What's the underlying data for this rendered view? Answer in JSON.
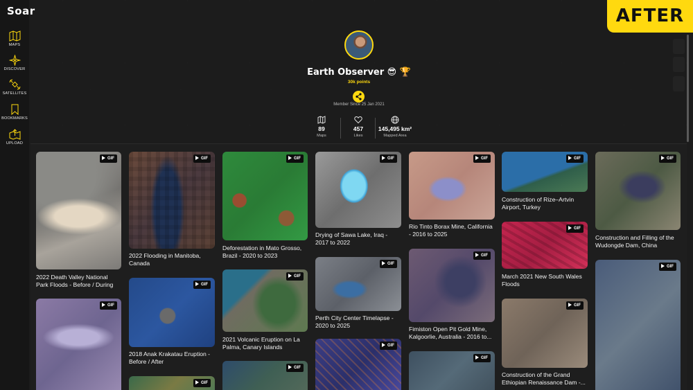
{
  "app": {
    "logo": "Soar",
    "badge": "AFTER"
  },
  "sidebar": {
    "items": [
      {
        "label": "MAPS",
        "icon": "map-icon"
      },
      {
        "label": "DISCOVER",
        "icon": "compass-icon"
      },
      {
        "label": "SATELLITES",
        "icon": "satellite-icon"
      },
      {
        "label": "BOOKMARKS",
        "icon": "bookmark-icon"
      },
      {
        "label": "UPLOAD",
        "icon": "upload-icon"
      }
    ]
  },
  "profile": {
    "name": "Earth Observer 😎 🏆",
    "points": "30k points",
    "member_since": "Member Since 25 Jan 2021",
    "stats": [
      {
        "value": "89",
        "label": "Maps",
        "icon": "map-icon"
      },
      {
        "value": "457",
        "label": "Likes",
        "icon": "heart-icon"
      },
      {
        "value": "145,495 km²",
        "label": "Mapped Area",
        "icon": "globe-icon"
      }
    ]
  },
  "gif_badge": "GIF",
  "colors": {
    "accent": "#ffd90f",
    "background": "#1b1b1b"
  },
  "cards": [
    {
      "title": "2022 Death Valley National Park Floods - Before / During"
    },
    {
      "title": ""
    },
    {
      "title": "2022 Flooding in Manitoba, Canada"
    },
    {
      "title": "2018 Anak Krakatau Eruption - Before / After"
    },
    {
      "title": ""
    },
    {
      "title": "Deforestation in Mato Grosso, Brazil - 2020 to 2023"
    },
    {
      "title": "2021 Volcanic Eruption on La Palma, Canary Islands"
    },
    {
      "title": ""
    },
    {
      "title": "Drying of Sawa Lake, Iraq - 2017 to 2022"
    },
    {
      "title": "Perth City Center Timelapse - 2020 to 2025"
    },
    {
      "title": ""
    },
    {
      "title": "Rio Tinto Borax Mine, California - 2016 to 2025"
    },
    {
      "title": "Fimiston Open Pit Gold Mine, Kalgoorlie, Australia - 2016 to..."
    },
    {
      "title": ""
    },
    {
      "title": "Construction of Rize–Artvin Airport, Turkey"
    },
    {
      "title": "March 2021 New South Wales Floods"
    },
    {
      "title": "Construction of the Grand Ethiopian Renaissance Dam -..."
    },
    {
      "title": "Construction and Filling of the Wudongde Dam, China"
    },
    {
      "title": ""
    }
  ]
}
